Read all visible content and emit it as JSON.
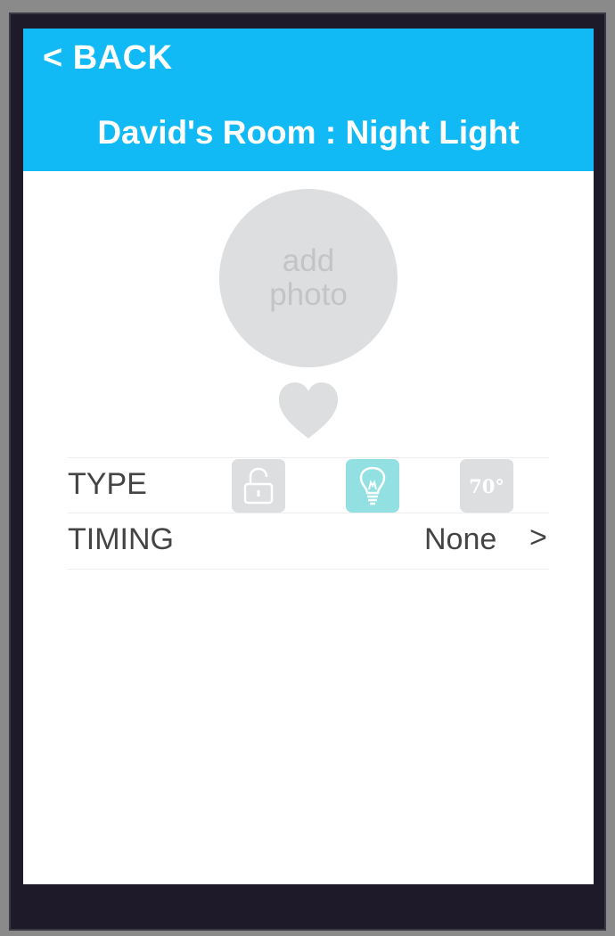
{
  "header": {
    "back_label": "< BACK",
    "title": "David's Room : Night Light",
    "background_color": "#12baf5"
  },
  "photo": {
    "line1": "add",
    "line2": "photo"
  },
  "favorite": {
    "icon": "heart-icon"
  },
  "type_row": {
    "label": "TYPE",
    "options": [
      {
        "name": "lock",
        "icon": "lock-icon",
        "selected": false
      },
      {
        "name": "light",
        "icon": "lightbulb-icon",
        "selected": true
      },
      {
        "name": "thermostat",
        "icon": "thermostat-icon",
        "text": "70°",
        "selected": false
      }
    ]
  },
  "timing_row": {
    "label": "TIMING",
    "value": "None",
    "chevron": ">"
  },
  "colors": {
    "accent": "#12baf5",
    "selected_option": "#92e0e2",
    "inactive": "#dcdee0"
  }
}
